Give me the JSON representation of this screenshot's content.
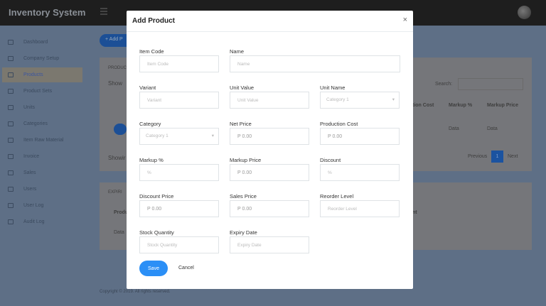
{
  "app": {
    "title": "Inventory System"
  },
  "sidebar": {
    "items": [
      {
        "label": "Dashboard",
        "icon": "dashboard-icon"
      },
      {
        "label": "Company Setup",
        "icon": "megaphone-icon"
      },
      {
        "label": "Products",
        "icon": "cart-icon",
        "active": true
      },
      {
        "label": "Product Sets",
        "icon": "cart-icon"
      },
      {
        "label": "Units",
        "icon": "truck-icon"
      },
      {
        "label": "Categories",
        "icon": "truck-icon"
      },
      {
        "label": "Item Raw Material",
        "icon": "file-icon"
      },
      {
        "label": "Invoice",
        "icon": "invoice-icon"
      },
      {
        "label": "Sales",
        "icon": "chart-icon"
      },
      {
        "label": "Users",
        "icon": "user-icon"
      },
      {
        "label": "User Log",
        "icon": "user-icon"
      },
      {
        "label": "Audit Log",
        "icon": "clock-icon"
      }
    ]
  },
  "main": {
    "add_label": "Add P",
    "products_title": "PRODUC",
    "show": "Show",
    "search_label": "Search:",
    "columns": [
      "tion Cost",
      "Markup %",
      "Markup Price"
    ],
    "row": [
      "Data",
      "Data"
    ],
    "showing": "Showir",
    "prev": "Previous",
    "page": "1",
    "next": "Next",
    "expiring_title": "EXPIRI",
    "exp_col": "Produ",
    "exp_col2": "nt",
    "exp_cell": "Data",
    "copyright": "Copyright © 2019. All rights reserved."
  },
  "modal": {
    "title": "Add Product",
    "close": "×",
    "save": "Save",
    "cancel": "Cancel",
    "fields": [
      {
        "label": "Item Code",
        "placeholder": "Item Code"
      },
      {
        "label": "Name",
        "placeholder": "Name"
      },
      {
        "label": "Variant",
        "placeholder": "Variant"
      },
      {
        "label": "Unit Value",
        "placeholder": "Unit Value"
      },
      {
        "label": "Unit Name",
        "value": "Category 1"
      },
      {
        "label": "Category",
        "value": "Category 1"
      },
      {
        "label": "Net Price",
        "placeholder": "P 0.00"
      },
      {
        "label": "Production Cost",
        "placeholder": "P 0.00"
      },
      {
        "label": "Markup %",
        "placeholder": "%"
      },
      {
        "label": "Markup Price",
        "placeholder": "P 0.00"
      },
      {
        "label": "Discount",
        "placeholder": "%"
      },
      {
        "label": "Discount Price",
        "placeholder": "P 0.00"
      },
      {
        "label": "Sales Price",
        "placeholder": "P 0.00"
      },
      {
        "label": "Reorder Level",
        "placeholder": "Reorder Level"
      },
      {
        "label": "Stock Quantity",
        "placeholder": "Stock Quantity"
      },
      {
        "label": "Expiry Date",
        "placeholder": "Expiry Date"
      }
    ]
  },
  "colors": {
    "accent": "#2b8ff6",
    "topbar": "#1e1e1e",
    "overlay_bg": "#5e6f86"
  }
}
